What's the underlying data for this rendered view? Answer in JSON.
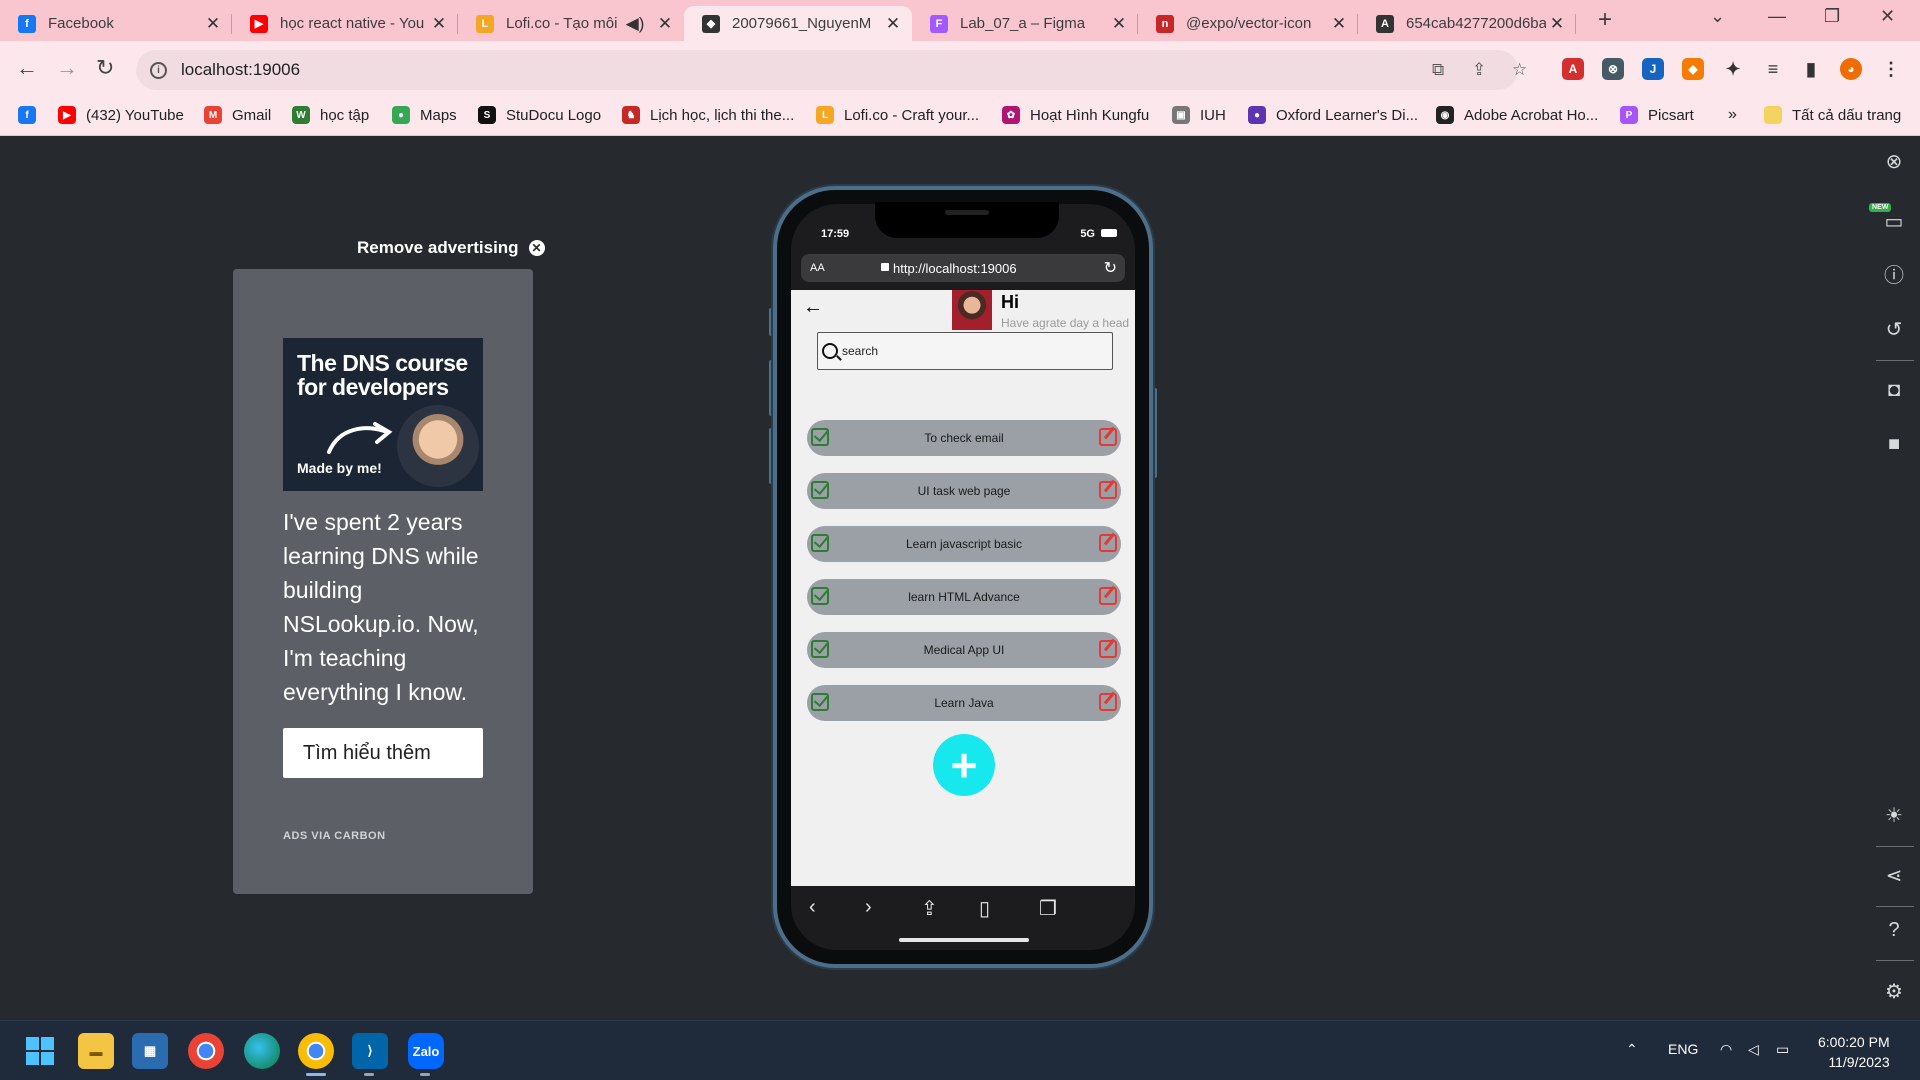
{
  "browser": {
    "tabs": [
      {
        "title": "Facebook",
        "color": "#1877f2",
        "glyph": "f"
      },
      {
        "title": "học react native - You",
        "color": "#ff0000",
        "glyph": "▶"
      },
      {
        "title": "Lofi.co - Tạo môi",
        "color": "#f5a623",
        "glyph": "L"
      },
      {
        "title": "20079661_NguyenM",
        "color": "#333333",
        "glyph": "◆"
      },
      {
        "title": "Lab_07_a – Figma",
        "color": "#a259ff",
        "glyph": "F"
      },
      {
        "title": "@expo/vector-icon",
        "color": "#c62828",
        "glyph": "n"
      },
      {
        "title": "654cab4277200d6ba",
        "color": "#333333",
        "glyph": "A"
      }
    ],
    "url": "localhost:19006",
    "bookmarks": [
      {
        "label": "",
        "color": "#1877f2",
        "glyph": "f"
      },
      {
        "label": "(432) YouTube",
        "color": "#ff0000",
        "glyph": "▶"
      },
      {
        "label": "Gmail",
        "color": "#ea4335",
        "glyph": "M"
      },
      {
        "label": "học tập",
        "color": "#2e7d32",
        "glyph": "W"
      },
      {
        "label": "Maps",
        "color": "#34a853",
        "glyph": "●"
      },
      {
        "label": "StuDocu Logo",
        "color": "#111111",
        "glyph": "S"
      },
      {
        "label": "Lịch học, lịch thi the...",
        "color": "#c62828",
        "glyph": "♞"
      },
      {
        "label": "Lofi.co - Craft your...",
        "color": "#f5a623",
        "glyph": "L"
      },
      {
        "label": "Hoạt Hình Kungfu",
        "color": "#b0166f",
        "glyph": "✿"
      },
      {
        "label": "IUH",
        "color": "#777777",
        "glyph": "▣"
      },
      {
        "label": "Oxford Learner's Di...",
        "color": "#5e35b1",
        "glyph": "●"
      },
      {
        "label": "Adobe Acrobat Ho...",
        "color": "#222222",
        "glyph": "◉"
      },
      {
        "label": "Picsart",
        "color": "#a855f7",
        "glyph": "P"
      }
    ],
    "more_bookmarks": "»",
    "all_bookmarks": "Tất cả dấu trang"
  },
  "ad": {
    "remove_label": "Remove advertising",
    "headline": "The DNS course for developers",
    "made_by": "Made by me!",
    "body": "I've spent 2 years learning DNS while building NSLookup.io. Now, I'm teaching everything I know.",
    "cta": "Tìm hiểu thêm",
    "via": "ADS VIA CARBON"
  },
  "phone": {
    "time": "17:59",
    "network": "5G",
    "aa": "AA",
    "url": "http://localhost:19006",
    "app": {
      "greeting": "Hi",
      "subtitle": "Have agrate day a head",
      "search_placeholder": "search",
      "tasks": [
        "To check email",
        "UI task web page",
        "Learn javascript basic",
        "learn HTML Advance",
        "Medical App UI",
        "Learn Java"
      ],
      "add_label": "+"
    }
  },
  "taskbar": {
    "lang": "ENG",
    "time": "6:00:20 PM",
    "date": "11/9/2023"
  }
}
